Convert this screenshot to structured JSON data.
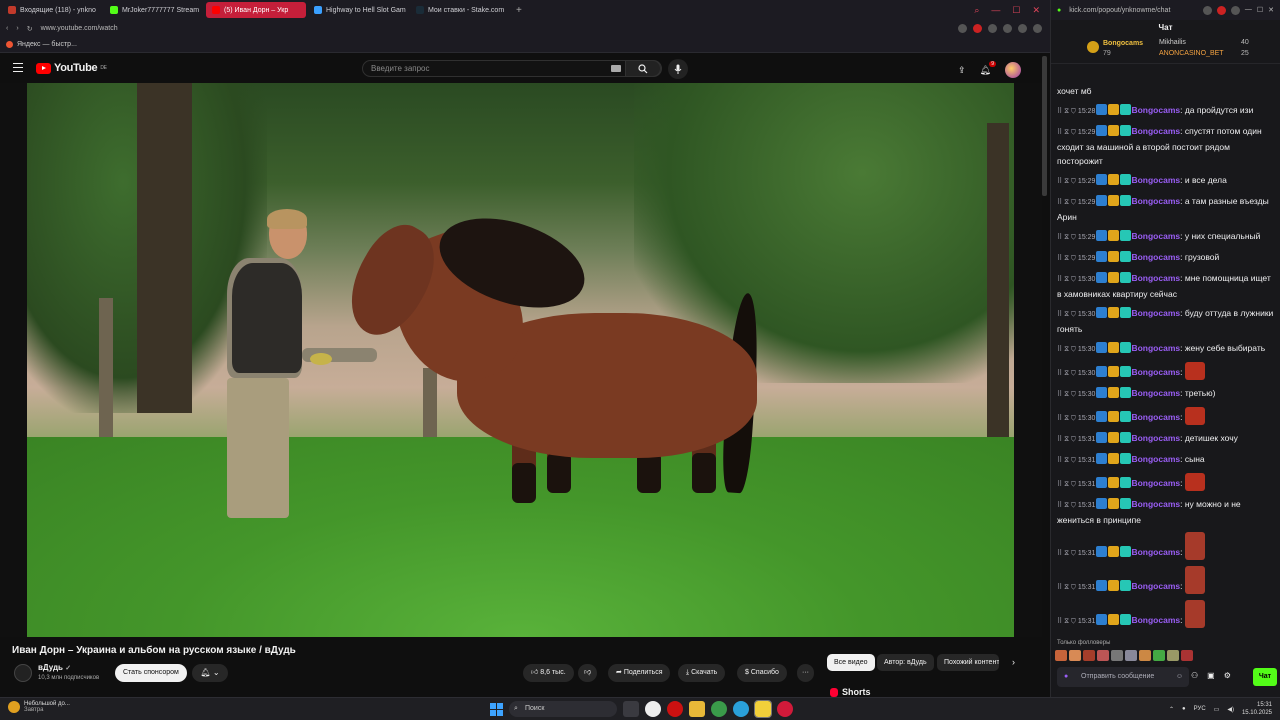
{
  "browser": {
    "tabs": [
      {
        "title": "Входящие (118) - ynkno",
        "color": "#c23a2b",
        "active": false
      },
      {
        "title": "MrJoker7777777 Stream",
        "color": "#53fc18",
        "active": false
      },
      {
        "title": "(5) Иван Дорн – Укр",
        "color": "#ff0000",
        "active": true
      },
      {
        "title": "Highway to Hell Slot Gam",
        "color": "#3aa0ff",
        "active": false
      },
      {
        "title": "Мои ставки - Stake.com",
        "color": "#1a2c38",
        "active": false
      }
    ],
    "new_tab": "+",
    "url": "www.youtube.com/watch",
    "bookmark": "Яндекс — быстр..."
  },
  "youtube": {
    "logo_text": "YouTube",
    "logo_region": "DE",
    "search_placeholder": "Введите запрос",
    "notif_count": "9",
    "video_title": "Иван Дорн – Украина и альбом на русском языке / вДудь",
    "channel_name": "вДудь",
    "channel_subs": "10,3 млн подписчиков",
    "sponsor_label": "Стать спонсором",
    "likes": "8,6 тыс.",
    "share_label": "Поделиться",
    "download_label": "Скачать",
    "thanks_label": "Спасибо",
    "more_label": "···",
    "chips": [
      {
        "label": "Все видео",
        "active": true
      },
      {
        "label": "Автор: вДудь",
        "active": false
      },
      {
        "label": "Похожий контент",
        "active": false
      }
    ],
    "shorts_label": "Shorts"
  },
  "chat": {
    "url": "kick.com/popout/ynknowme/chat",
    "title": "Чат",
    "leaderboard": {
      "first_name": "Bongocams",
      "first_value": "79",
      "second_name": "Mikhailis",
      "second_value": "40",
      "third_name": "ANONCASINO_BET",
      "third_value": "25"
    },
    "partial_top": "хочет мб",
    "messages": [
      {
        "time": "15:28",
        "user": "Bongocams",
        "text": "да пройдутся изи",
        "emote": ""
      },
      {
        "time": "15:29",
        "user": "Bongocams",
        "text": "спустят потом один сходит за машиной а второй постоит рядом посторожит",
        "emote": ""
      },
      {
        "time": "15:29",
        "user": "Bongocams",
        "text": "и все дела",
        "emote": ""
      },
      {
        "time": "15:29",
        "user": "Bongocams",
        "text": "а там разные въезды Арин",
        "emote": ""
      },
      {
        "time": "15:29",
        "user": "Bongocams",
        "text": "у них специальный",
        "emote": ""
      },
      {
        "time": "15:29",
        "user": "Bongocams",
        "text": "грузовой",
        "emote": ""
      },
      {
        "time": "15:30",
        "user": "Bongocams",
        "text": "мне помощница ищет в хамовниках квартиру сейчас",
        "emote": ""
      },
      {
        "time": "15:30",
        "user": "Bongocams",
        "text": "буду оттуда в лужники гонять",
        "emote": ""
      },
      {
        "time": "15:30",
        "user": "Bongocams",
        "text": "жену себе выбирать",
        "emote": ""
      },
      {
        "time": "15:30",
        "user": "Bongocams",
        "text": "",
        "emote": "face"
      },
      {
        "time": "15:30",
        "user": "Bongocams",
        "text": "третью)",
        "emote": ""
      },
      {
        "time": "15:30",
        "user": "Bongocams",
        "text": "",
        "emote": "face"
      },
      {
        "time": "15:31",
        "user": "Bongocams",
        "text": "детишек хочу",
        "emote": ""
      },
      {
        "time": "15:31",
        "user": "Bongocams",
        "text": "сына",
        "emote": ""
      },
      {
        "time": "15:31",
        "user": "Bongocams",
        "text": "",
        "emote": "face"
      },
      {
        "time": "15:31",
        "user": "Bongocams",
        "text": "ну можно и не жениться в принципе",
        "emote": ""
      },
      {
        "time": "15:31",
        "user": "Bongocams",
        "text": "",
        "emote": "tall"
      },
      {
        "time": "15:31",
        "user": "Bongocams",
        "text": "",
        "emote": "tall"
      },
      {
        "time": "15:31",
        "user": "Bongocams",
        "text": "",
        "emote": "tall"
      }
    ],
    "followers_only": "Только фолловеры",
    "input_placeholder": "Отправить сообщение",
    "send_label": "Чат"
  },
  "taskbar": {
    "weather_title": "Небольшой до...",
    "weather_sub": "Завтра",
    "search_label": "Поиск",
    "lang": "РУС",
    "time": "15:31",
    "date": "15.10.2025"
  }
}
